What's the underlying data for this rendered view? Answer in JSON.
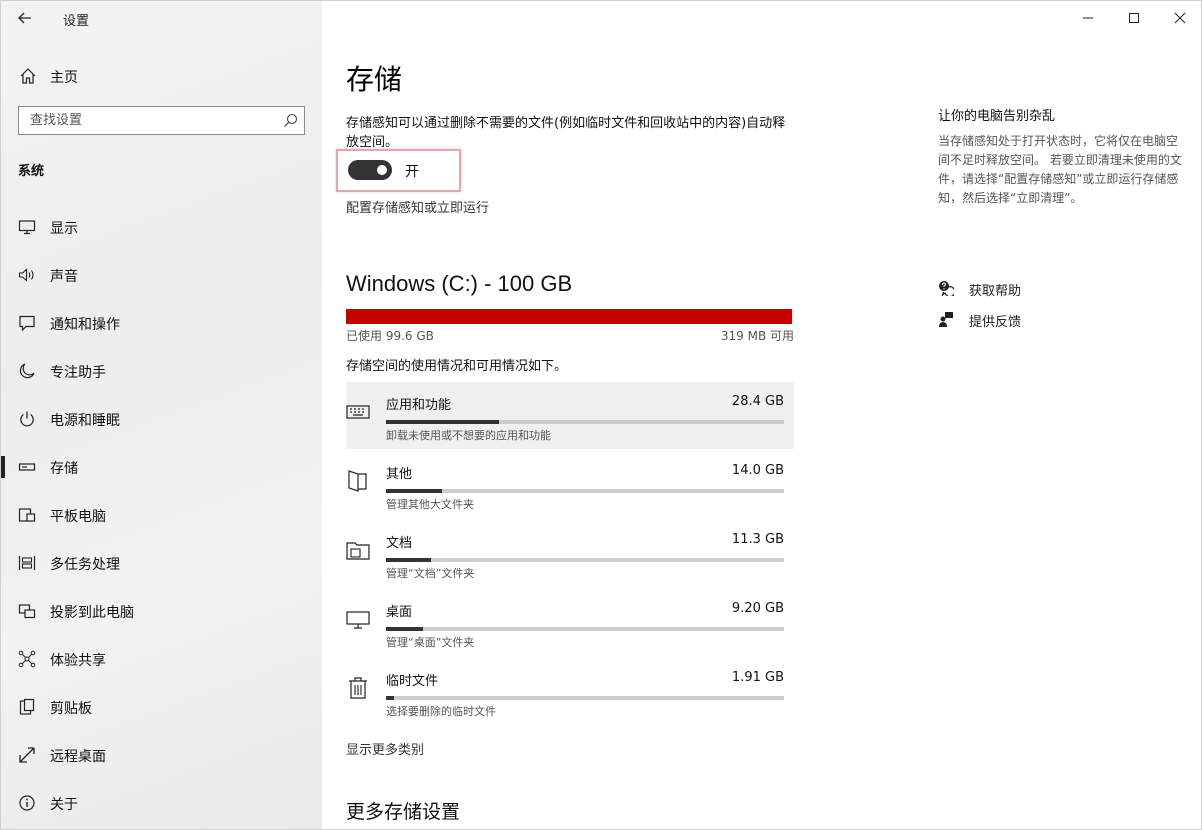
{
  "window": {
    "title": "设置"
  },
  "sidebar": {
    "home_label": "主页",
    "search_placeholder": "查找设置",
    "section": "系统",
    "items": [
      {
        "label": "显示",
        "icon": "monitor-icon"
      },
      {
        "label": "声音",
        "icon": "speaker-icon"
      },
      {
        "label": "通知和操作",
        "icon": "notification-icon"
      },
      {
        "label": "专注助手",
        "icon": "moon-icon"
      },
      {
        "label": "电源和睡眠",
        "icon": "power-icon"
      },
      {
        "label": "存储",
        "icon": "storage-icon",
        "active": true
      },
      {
        "label": "平板电脑",
        "icon": "tablet-icon"
      },
      {
        "label": "多任务处理",
        "icon": "multitask-icon"
      },
      {
        "label": "投影到此电脑",
        "icon": "project-icon"
      },
      {
        "label": "体验共享",
        "icon": "share-icon"
      },
      {
        "label": "剪贴板",
        "icon": "clipboard-icon"
      },
      {
        "label": "远程桌面",
        "icon": "remote-desktop-icon"
      },
      {
        "label": "关于",
        "icon": "info-icon"
      }
    ]
  },
  "main": {
    "title": "存储",
    "description": "存储感知可以通过删除不需要的文件(例如临时文件和回收站中的内容)自动释放空间。",
    "toggle_state": "开",
    "toggle_on": true,
    "config_link": "配置存储感知或立即运行",
    "drive": {
      "title": "Windows (C:) - 100 GB",
      "used": "已使用 99.6 GB",
      "free": "319 MB 可用",
      "used_fraction": 0.996
    },
    "usage_heading": "存储空间的使用情况和可用情况如下。",
    "categories": [
      {
        "name": "应用和功能",
        "size": "28.4 GB",
        "sub": "卸载未使用或不想要的应用和功能",
        "fraction": 0.284,
        "icon": "keyboard-icon"
      },
      {
        "name": "其他",
        "size": "14.0 GB",
        "sub": "管理其他大文件夹",
        "fraction": 0.14,
        "icon": "other-folder-icon"
      },
      {
        "name": "文档",
        "size": "11.3 GB",
        "sub": "管理“文档”文件夹",
        "fraction": 0.113,
        "icon": "documents-folder-icon"
      },
      {
        "name": "桌面",
        "size": "9.20 GB",
        "sub": "管理“桌面”文件夹",
        "fraction": 0.092,
        "icon": "desktop-icon"
      },
      {
        "name": "临时文件",
        "size": "1.91 GB",
        "sub": "选择要删除的临时文件",
        "fraction": 0.019,
        "icon": "trash-icon"
      }
    ],
    "more_categories_link": "显示更多类别",
    "more_settings_heading": "更多存储设置"
  },
  "side_panel": {
    "heading": "让你的电脑告别杂乱",
    "text": "当存储感知处于打开状态时，它将仅在电脑空间不足时释放空间。 若要立即清理未使用的文件，请选择“配置存储感知”或立即运行存储感知，然后选择“立即清理”。",
    "help_links": [
      {
        "label": "获取帮助",
        "icon": "help-chat-icon"
      },
      {
        "label": "提供反馈",
        "icon": "feedback-icon"
      }
    ]
  },
  "colors": {
    "drive_bar": "#c50000",
    "toggle_on": "#333333",
    "highlight": "#f0f0f0"
  }
}
